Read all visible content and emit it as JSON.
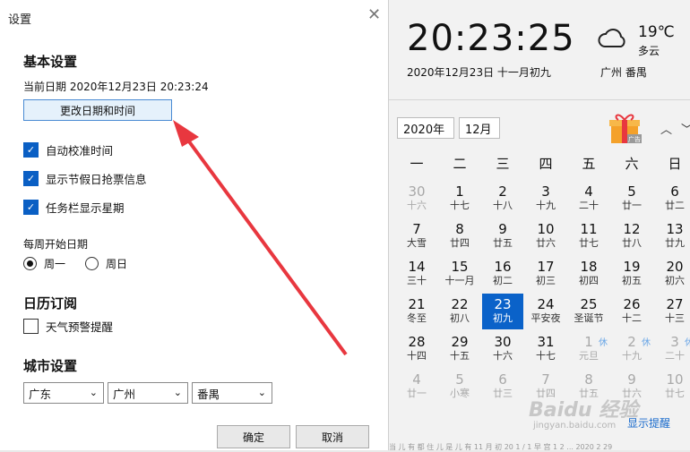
{
  "dialog": {
    "title": "设置",
    "basic_heading": "基本设置",
    "current_date_text": "当前日期  2020年12月23日  20:23:24",
    "change_button": "更改日期和时间",
    "checkboxes": [
      {
        "label": "自动校准时间",
        "checked": true
      },
      {
        "label": "显示节假日抢票信息",
        "checked": true
      },
      {
        "label": "任务栏显示星期",
        "checked": true
      }
    ],
    "week_start_label": "每周开始日期",
    "week_options": [
      {
        "label": "周一",
        "selected": true
      },
      {
        "label": "周日",
        "selected": false
      }
    ],
    "calendar_sub_heading": "日历订阅",
    "weather_alert": {
      "label": "天气预警提醒",
      "checked": false
    },
    "city_heading": "城市设置",
    "province": "广东",
    "city": "广州",
    "district": "番禺",
    "ok_button": "确定",
    "cancel_button": "取消"
  },
  "panel": {
    "time": "20:23:25",
    "date_line": "2020年12月23日   十一月初九",
    "temperature": "19℃",
    "condition": "多云",
    "location": "广州 番禺",
    "year_select": "2020年",
    "month_select": "12月",
    "gift_badge": "广告",
    "weekdays": [
      "一",
      "二",
      "三",
      "四",
      "五",
      "六",
      "日"
    ],
    "weeks": [
      [
        {
          "d": "30",
          "l": "十六",
          "g": true
        },
        {
          "d": "1",
          "l": "十七"
        },
        {
          "d": "2",
          "l": "十八"
        },
        {
          "d": "3",
          "l": "十九"
        },
        {
          "d": "4",
          "l": "二十"
        },
        {
          "d": "5",
          "l": "廿一"
        },
        {
          "d": "6",
          "l": "廿二"
        }
      ],
      [
        {
          "d": "7",
          "l": "大雪"
        },
        {
          "d": "8",
          "l": "廿四"
        },
        {
          "d": "9",
          "l": "廿五"
        },
        {
          "d": "10",
          "l": "廿六"
        },
        {
          "d": "11",
          "l": "廿七"
        },
        {
          "d": "12",
          "l": "廿八"
        },
        {
          "d": "13",
          "l": "廿九"
        }
      ],
      [
        {
          "d": "14",
          "l": "三十"
        },
        {
          "d": "15",
          "l": "十一月"
        },
        {
          "d": "16",
          "l": "初二"
        },
        {
          "d": "17",
          "l": "初三"
        },
        {
          "d": "18",
          "l": "初四"
        },
        {
          "d": "19",
          "l": "初五"
        },
        {
          "d": "20",
          "l": "初六"
        }
      ],
      [
        {
          "d": "21",
          "l": "冬至"
        },
        {
          "d": "22",
          "l": "初八"
        },
        {
          "d": "23",
          "l": "初九",
          "t": true
        },
        {
          "d": "24",
          "l": "平安夜"
        },
        {
          "d": "25",
          "l": "圣诞节"
        },
        {
          "d": "26",
          "l": "十二"
        },
        {
          "d": "27",
          "l": "十三"
        }
      ],
      [
        {
          "d": "28",
          "l": "十四"
        },
        {
          "d": "29",
          "l": "十五"
        },
        {
          "d": "30",
          "l": "十六"
        },
        {
          "d": "31",
          "l": "十七"
        },
        {
          "d": "1",
          "l": "元旦",
          "g": true,
          "r": "休"
        },
        {
          "d": "2",
          "l": "十九",
          "g": true,
          "r": "休"
        },
        {
          "d": "3",
          "l": "二十",
          "g": true,
          "r": "休"
        }
      ],
      [
        {
          "d": "4",
          "l": "廿一",
          "g": true
        },
        {
          "d": "5",
          "l": "小寒",
          "g": true
        },
        {
          "d": "6",
          "l": "廿三",
          "g": true
        },
        {
          "d": "7",
          "l": "廿四",
          "g": true
        },
        {
          "d": "8",
          "l": "廿五",
          "g": true
        },
        {
          "d": "9",
          "l": "廿六",
          "g": true
        },
        {
          "d": "10",
          "l": "廿七",
          "g": true
        }
      ]
    ],
    "remind_link": "显示提醒",
    "footer_text": "当 儿 有 都 住 儿 是 儿 有 11 月 初 20 1 / 1 早 宫 1 2 ... 2020 2 29"
  },
  "watermark": {
    "main": "Baidu 经验",
    "sub": "jingyan.baidu.com"
  },
  "colors": {
    "accent": "#0a62c9",
    "arrow": "#e8373f"
  }
}
